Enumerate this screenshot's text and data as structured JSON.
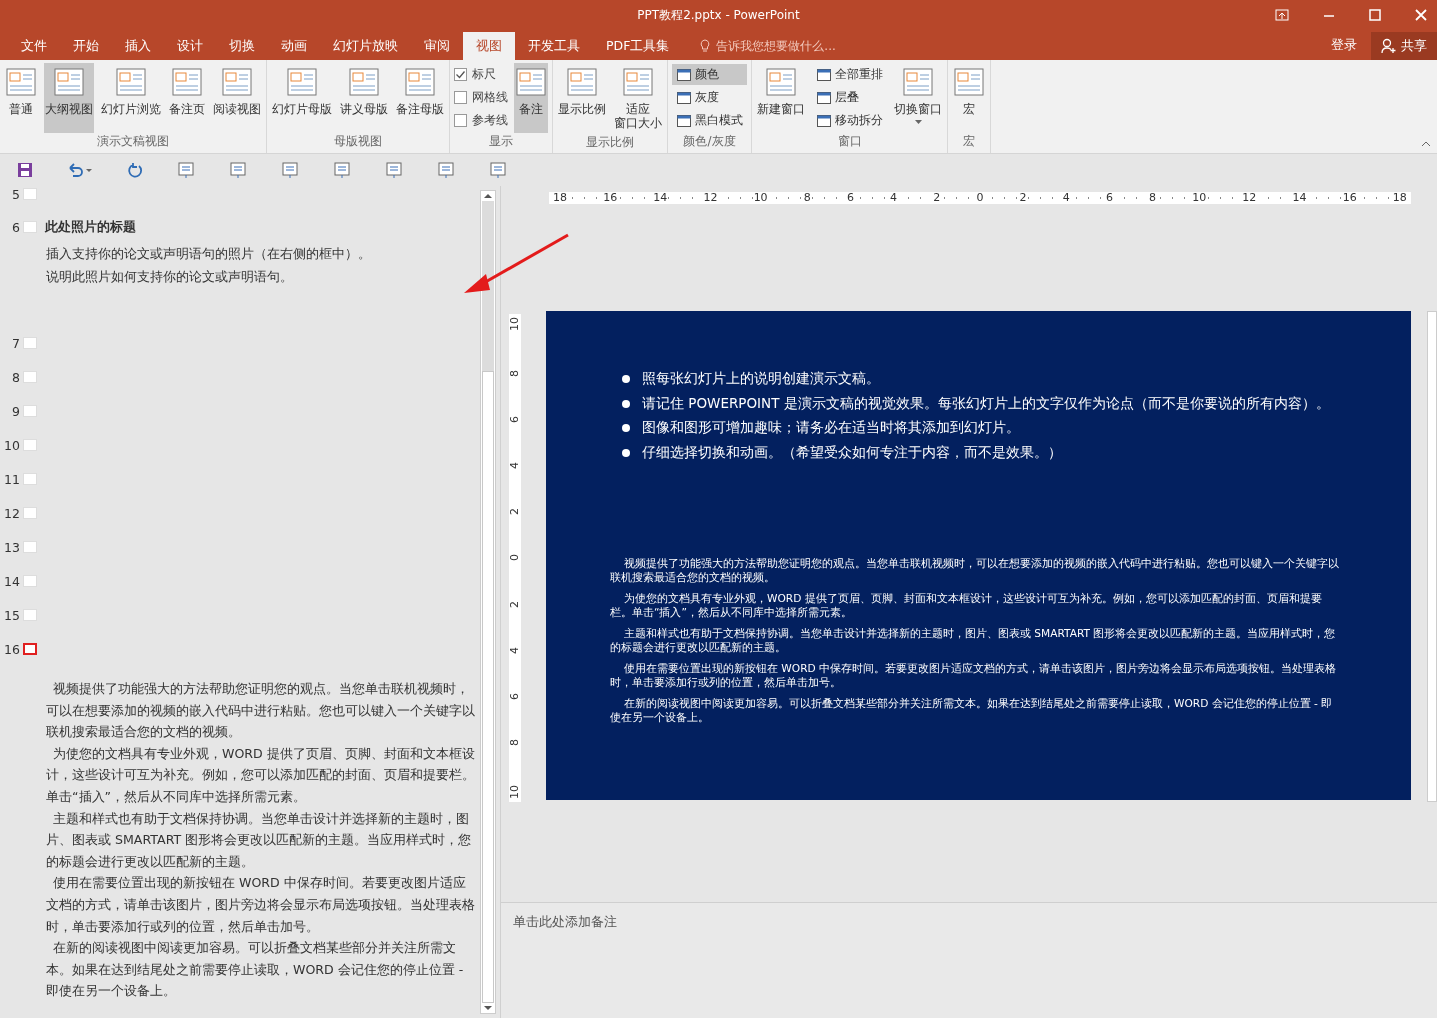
{
  "window": {
    "title": "PPT教程2.pptx - PowerPoint"
  },
  "tabs": [
    {
      "label": "文件",
      "selected": false
    },
    {
      "label": "开始",
      "selected": false
    },
    {
      "label": "插入",
      "selected": false
    },
    {
      "label": "设计",
      "selected": false
    },
    {
      "label": "切换",
      "selected": false
    },
    {
      "label": "动画",
      "selected": false
    },
    {
      "label": "幻灯片放映",
      "selected": false
    },
    {
      "label": "审阅",
      "selected": false
    },
    {
      "label": "视图",
      "selected": true
    },
    {
      "label": "开发工具",
      "selected": false
    },
    {
      "label": "PDF工具集",
      "selected": false
    }
  ],
  "tell_me": {
    "placeholder": "告诉我您想要做什么..."
  },
  "account": {
    "sign_in": "登录",
    "share": "共享"
  },
  "ribbon_groups": [
    {
      "label": "演示文稿视图",
      "items": [
        {
          "kind": "large",
          "label": "普通",
          "selected": false
        },
        {
          "kind": "large",
          "label": "大纲视图",
          "selected": true
        },
        {
          "kind": "large",
          "label": "幻灯片浏览",
          "selected": false
        },
        {
          "kind": "large",
          "label": "备注页",
          "selected": false
        },
        {
          "kind": "large",
          "label": "阅读视图",
          "selected": false
        }
      ]
    },
    {
      "label": "母版视图",
      "items": [
        {
          "kind": "large",
          "label": "幻灯片母版",
          "selected": false
        },
        {
          "kind": "large",
          "label": "讲义母版",
          "selected": false
        },
        {
          "kind": "large",
          "label": "备注母版",
          "selected": false
        }
      ]
    },
    {
      "label": "显示",
      "items": [
        {
          "kind": "check",
          "label": "标尺",
          "checked": true
        },
        {
          "kind": "check",
          "label": "网格线",
          "checked": false
        },
        {
          "kind": "check",
          "label": "参考线",
          "checked": false
        },
        {
          "kind": "large",
          "label": "备注",
          "selected": true
        }
      ]
    },
    {
      "label": "显示比例",
      "items": [
        {
          "kind": "large",
          "label": "显示比例",
          "selected": false
        },
        {
          "kind": "large",
          "label_lines": [
            "适应",
            "窗口大小"
          ],
          "selected": false
        }
      ]
    },
    {
      "label": "颜色/灰度",
      "items": [
        {
          "kind": "small",
          "label": "颜色",
          "selected": true
        },
        {
          "kind": "small",
          "label": "灰度",
          "selected": false
        },
        {
          "kind": "small",
          "label": "黑白模式",
          "selected": false
        }
      ]
    },
    {
      "label": "窗口",
      "items": [
        {
          "kind": "large",
          "label": "新建窗口",
          "selected": false
        },
        {
          "kind": "small",
          "label": "全部重排",
          "selected": false
        },
        {
          "kind": "small",
          "label": "层叠",
          "selected": false
        },
        {
          "kind": "small",
          "label": "移动拆分",
          "selected": false
        },
        {
          "kind": "large",
          "label": "切换窗口",
          "selected": false
        }
      ]
    },
    {
      "label": "宏",
      "items": [
        {
          "kind": "large",
          "label": "宏",
          "selected": false
        }
      ]
    }
  ],
  "outline": {
    "slides": [
      {
        "number": "5",
        "selected": false
      },
      {
        "number": "6",
        "selected": false,
        "title": "此处照片的标题",
        "lines": [
          "插入支持你的论文或声明语句的照片（在右侧的框中）。",
          "说明此照片如何支持你的论文或声明语句。"
        ]
      },
      {
        "number": "7",
        "selected": false
      },
      {
        "number": "8",
        "selected": false
      },
      {
        "number": "9",
        "selected": false
      },
      {
        "number": "10",
        "selected": false
      },
      {
        "number": "11",
        "selected": false
      },
      {
        "number": "12",
        "selected": false
      },
      {
        "number": "13",
        "selected": false
      },
      {
        "number": "14",
        "selected": false
      },
      {
        "number": "15",
        "selected": false
      },
      {
        "number": "16",
        "selected": true,
        "paragraphs": [
          "视频提供了功能强大的方法帮助您证明您的观点。当您单击联机视频时，可以在想要添加的视频的嵌入代码中进行粘贴。您也可以键入一个关键字以联机搜索最适合您的文档的视频。",
          "为使您的文档具有专业外观，WORD 提供了页眉、页脚、封面和文本框设计，这些设计可互为补充。例如，您可以添加匹配的封面、页眉和提要栏。单击“插入”，然后从不同库中选择所需元素。",
          "主题和样式也有助于文档保持协调。当您单击设计并选择新的主题时，图片、图表或 SMARTART 图形将会更改以匹配新的主题。当应用样式时，您的标题会进行更改以匹配新的主题。",
          "使用在需要位置出现的新按钮在 WORD 中保存时间。若要更改图片适应文档的方式，请单击该图片，图片旁边将会显示布局选项按钮。当处理表格时，单击要添加行或列的位置，然后单击加号。",
          "在新的阅读视图中阅读更加容易。可以折叠文档某些部分并关注所需文本。如果在达到结尾处之前需要停止读取，WORD 会记住您的停止位置 - 即使在另一个设备上。"
        ]
      }
    ]
  },
  "ruler": {
    "horizontal": [
      "18",
      "16",
      "14",
      "12",
      "10",
      "8",
      "6",
      "4",
      "2",
      "0",
      "2",
      "4",
      "6",
      "8",
      "10",
      "12",
      "14",
      "16",
      "18"
    ],
    "vertical": [
      "10",
      "8",
      "6",
      "4",
      "2",
      "0",
      "2",
      "4",
      "6",
      "8",
      "10"
    ]
  },
  "slide": {
    "bullets": [
      "照每张幻灯片上的说明创建演示文稿。",
      "请记住 POWERPOINT 是演示文稿的视觉效果。每张幻灯片上的文字仅作为论点（而不是你要说的所有内容）。",
      "图像和图形可增加趣味；请务必在适当时将其添加到幻灯片。",
      "仔细选择切换和动画。（希望受众如何专注于内容，而不是效果。）"
    ],
    "paragraphs": [
      "视频提供了功能强大的方法帮助您证明您的观点。当您单击联机视频时，可以在想要添加的视频的嵌入代码中进行粘贴。您也可以键入一个关键字以联机搜索最适合您的文档的视频。",
      "为使您的文档具有专业外观，WORD 提供了页眉、页脚、封面和文本框设计，这些设计可互为补充。例如，您可以添加匹配的封面、页眉和提要栏。单击“插入”，然后从不同库中选择所需元素。",
      "主题和样式也有助于文档保持协调。当您单击设计并选择新的主题时，图片、图表或 SMARTART 图形将会更改以匹配新的主题。当应用样式时，您的标题会进行更改以匹配新的主题。",
      "使用在需要位置出现的新按钮在 WORD 中保存时间。若要更改图片适应文档的方式，请单击该图片，图片旁边将会显示布局选项按钮。当处理表格时，单击要添加行或列的位置，然后单击加号。",
      "在新的阅读视图中阅读更加容易。可以折叠文档某些部分并关注所需文本。如果在达到结尾处之前需要停止读取，WORD 会记住您的停止位置 - 即使在另一个设备上。"
    ]
  },
  "notes": {
    "placeholder": "单击此处添加备注"
  }
}
